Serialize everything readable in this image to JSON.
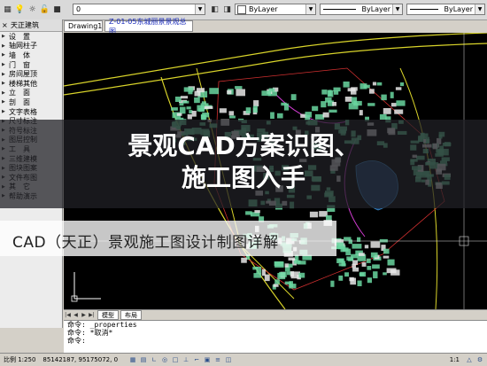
{
  "toolbar": {
    "layer_value": "0",
    "color_value": "ByLayer",
    "linetype_value": "ByLayer",
    "lineweight_value": "ByLayer",
    "icons": [
      "layer-manager-icon",
      "lightbulb-icon",
      "sun-icon",
      "lock-icon",
      "color-square-icon"
    ]
  },
  "palette": {
    "title": "天正建筑",
    "items": [
      "设　置",
      "轴网柱子",
      "墙　体",
      "门　窗",
      "房间屋顶",
      "楼梯其他",
      "立　面",
      "剖　面",
      "文字表格",
      "尺寸标注",
      "符号标注",
      "图层控制",
      "工　具",
      "三维建模",
      "图块图案",
      "文件布图",
      "其　它",
      "帮助演示"
    ]
  },
  "tabs": {
    "drawing1": "Drawing1",
    "active": "Z-01-05东城丽景景观总图"
  },
  "layout_tabs": [
    "模型",
    "布局"
  ],
  "command": {
    "lines": [
      "命令: _properties",
      "命令: *取消*",
      "命令:"
    ]
  },
  "status": {
    "scale": "比例 1:250",
    "coords": "85142187, 95175072, 0",
    "annotation_scale": "1:1"
  },
  "overlay": {
    "title_line1": "景观CAD方案识图、",
    "title_line2": "施工图入手",
    "subtitle": "CAD（天正）景观施工图设计制图详解"
  },
  "colors": {
    "canvas_bg": "#000000",
    "building_fill": "#6ad6a0",
    "road_line": "#d9d42a",
    "water": "#3a8fd0",
    "overlay_dark": "#202026",
    "overlay_light": "#ffffff"
  }
}
